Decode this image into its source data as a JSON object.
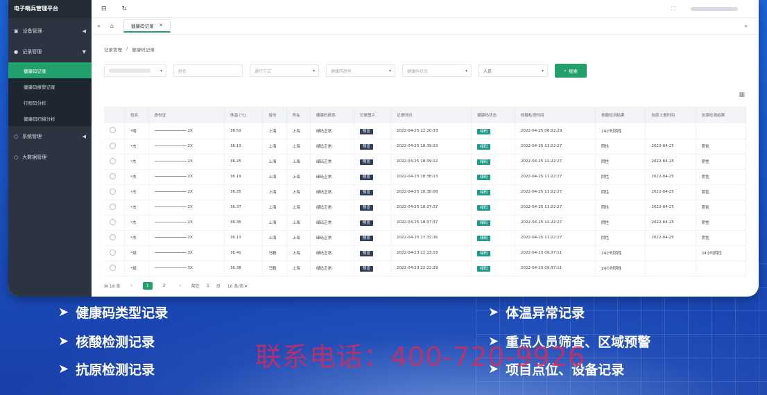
{
  "app": {
    "title": "电子哨兵管理平台"
  },
  "sidebar": {
    "items": [
      {
        "label": "设备管理",
        "icon": "device-icon",
        "arrow": "◀"
      },
      {
        "label": "记录管理",
        "icon": "record-icon",
        "arrow": "▼"
      },
      {
        "label": "系统管理",
        "icon": "settings-icon",
        "arrow": "◀"
      },
      {
        "label": "大数据管理",
        "icon": "bigdata-icon",
        "arrow": ""
      }
    ],
    "sub_items": [
      {
        "label": "健康码记录",
        "active": true
      },
      {
        "label": "健康码报警记录",
        "active": false
      },
      {
        "label": "行程码分析",
        "active": false
      },
      {
        "label": "健康码扫描分析",
        "active": false
      }
    ]
  },
  "tabs": {
    "home_icon": "home-icon",
    "active_tab": "健康码记录"
  },
  "breadcrumb": [
    "记录管理",
    "健康码记录"
  ],
  "filters": [
    {
      "placeholder": "",
      "width": 90
    },
    {
      "placeholder": "姓名",
      "width": 100
    },
    {
      "placeholder": "通行方式",
      "width": 100
    },
    {
      "placeholder": "健康码颜色",
      "width": 100
    },
    {
      "placeholder": "健康码状态",
      "width": 100
    },
    {
      "placeholder": "人员",
      "width": 100
    }
  ],
  "search_button": "搜索",
  "table": {
    "headers": [
      "",
      "姓名",
      "身份证",
      "体温 (℃)",
      "省份",
      "所在",
      "健康码颜色",
      "记录图片",
      "记录时间",
      "健康码状态",
      "核酸检测时间",
      "核酸检测结果",
      "抗原上报时间",
      "抗原检测结果"
    ],
    "rows": [
      [
        "",
        "*明",
        "2X",
        "36.53",
        "上海",
        "上海",
        "绿码正常",
        "预览",
        "2022-04-25 22:20:33",
        "绿码",
        "2022-04-25 08:22:29",
        "24小时阴性",
        "",
        ""
      ],
      [
        "",
        "*杰",
        "2X",
        "36.13",
        "上海",
        "上海",
        "绿码正常",
        "预览",
        "2022-04-25 18:39:23",
        "绿码",
        "2022-04-25 11:22:27",
        "阴性",
        "2022-04-25",
        "阴性"
      ],
      [
        "",
        "*杰",
        "2X",
        "36.25",
        "上海",
        "上海",
        "绿码正常",
        "预览",
        "2022-04-25 18:39:12",
        "绿码",
        "2022-04-25 11:22:27",
        "阴性",
        "2022-04-25",
        "阴性"
      ],
      [
        "",
        "*杰",
        "2X",
        "36.19",
        "上海",
        "上海",
        "绿码正常",
        "预览",
        "2022-04-25 18:38:13",
        "绿码",
        "2022-04-25 11:22:27",
        "阴性",
        "2022-04-25",
        "阴性"
      ],
      [
        "",
        "*杰",
        "2X",
        "36.25",
        "上海",
        "上海",
        "绿码正常",
        "预览",
        "2022-04-25 18:38:08",
        "绿码",
        "2022-04-25 11:22:27",
        "阴性",
        "2022-04-25",
        "阴性"
      ],
      [
        "",
        "*杰",
        "2X",
        "36.37",
        "上海",
        "上海",
        "绿码正常",
        "预览",
        "2022-04-25 18:37:37",
        "绿码",
        "2022-04-25 11:22:27",
        "阴性",
        "2022-04-25",
        "阴性"
      ],
      [
        "",
        "*杰",
        "2X",
        "36.36",
        "上海",
        "上海",
        "绿码正常",
        "预览",
        "2022-04-25 18:37:37",
        "绿码",
        "2022-04-25 11:22:27",
        "阴性",
        "2022-04-25",
        "阴性"
      ],
      [
        "",
        "*杰",
        "2X",
        "36.13",
        "上海",
        "上海",
        "绿码正常",
        "预览",
        "2022-04-25 17:32:36",
        "绿码",
        "2022-04-25 11:22:27",
        "阴性",
        "2022-04-25",
        "阴性"
      ],
      [
        "",
        "*斌",
        "3X",
        "36.41",
        "马鞍",
        "上海",
        "绿码正常",
        "预览",
        "2022-04-23 22:23:03",
        "绿码",
        "2022-04-23 09:37:11",
        "24小时阴性",
        "",
        "24小时阴性"
      ],
      [
        "",
        "*斌",
        "3X",
        "36.38",
        "马鞍",
        "上海",
        "绿码正常",
        "预览",
        "2022-04-23 22:22:29",
        "绿码",
        "2022-04-23 09:37:11",
        "24小时阴性",
        "",
        ""
      ]
    ]
  },
  "pager": {
    "total": "共 18 条",
    "prev": "‹",
    "pages": [
      "1",
      "2"
    ],
    "next": "›",
    "goto": "前往",
    "page_input": "1",
    "page_unit": "页",
    "size": "10 条/页"
  },
  "features_left": [
    "健康码类型记录",
    "核酸检测记录",
    "抗原检测记录"
  ],
  "features_right": [
    "体温异常记录",
    "重点人员筛查、区域预警",
    "项目点位、设备记录"
  ],
  "contact": "联系电话：400-720-9926",
  "colors": {
    "accent": "#22a06b",
    "sidebar": "#2b3440",
    "tag_dark": "#2f3e56",
    "tag_green": "#1f9a8a"
  }
}
